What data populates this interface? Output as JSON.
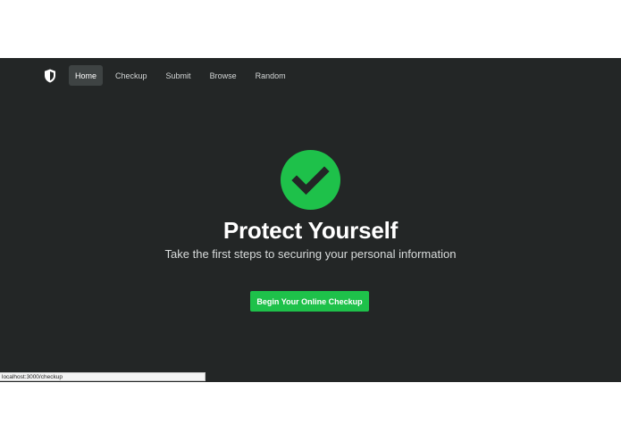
{
  "nav": {
    "brand_icon": "shield-icon",
    "items": [
      {
        "label": "Home",
        "active": true
      },
      {
        "label": "Checkup",
        "active": false
      },
      {
        "label": "Submit",
        "active": false
      },
      {
        "label": "Browse",
        "active": false
      },
      {
        "label": "Random",
        "active": false
      }
    ]
  },
  "hero": {
    "icon": "check-circle-icon",
    "title": "Protect Yourself",
    "subtitle": "Take the first steps to securing your personal information",
    "cta_label": "Begin Your Online Checkup"
  },
  "status_bar": {
    "url": "localhost:3000/checkup"
  },
  "colors": {
    "background": "#232626",
    "accent": "#1ec14a",
    "nav_active_bg": "#3e4343"
  }
}
